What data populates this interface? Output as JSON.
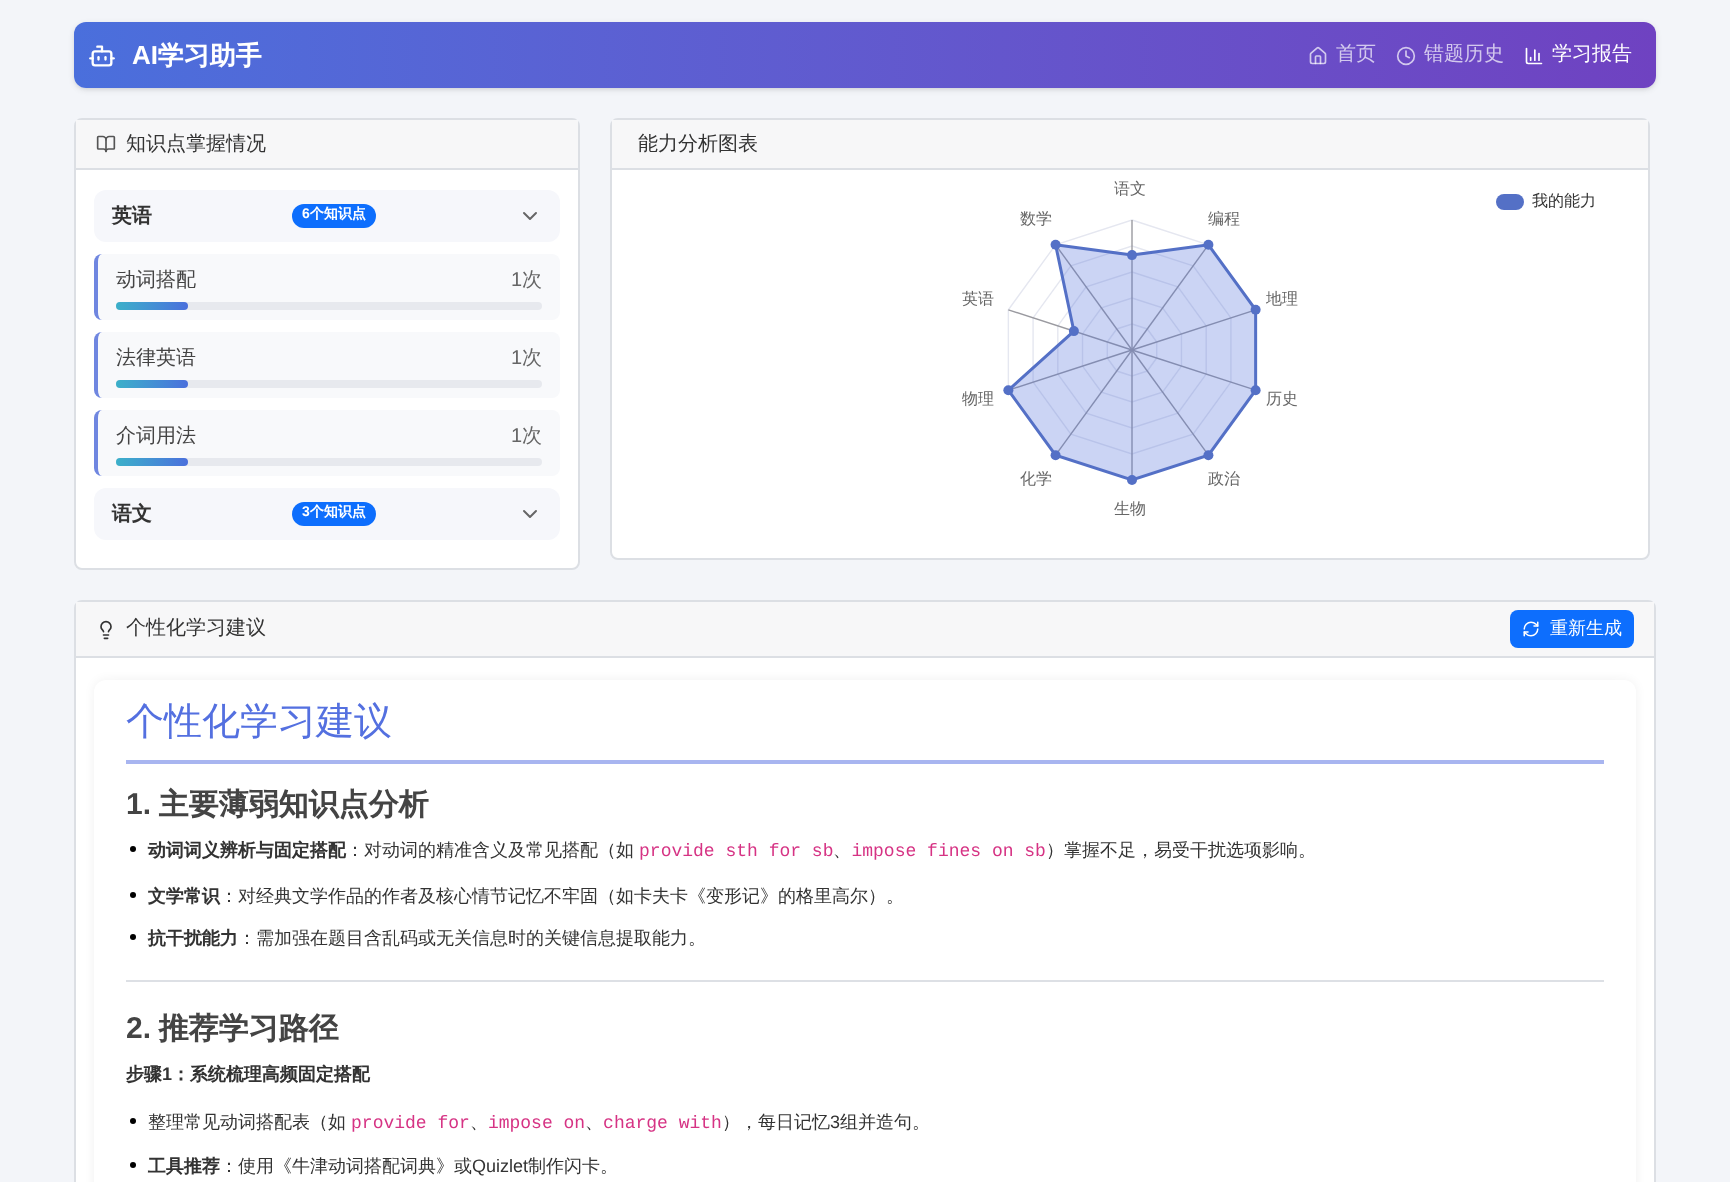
{
  "header": {
    "title": "AI学习助手",
    "nav": [
      {
        "label": "首页",
        "kind": "home",
        "selected": false
      },
      {
        "label": "错题历史",
        "kind": "history",
        "selected": false
      },
      {
        "label": "学习报告",
        "kind": "report",
        "selected": true
      }
    ]
  },
  "knowledge": {
    "title": "知识点掌握情况",
    "subjects": [
      {
        "name": "英语",
        "badge": "6个知识点",
        "points": [
          {
            "name": "动词搭配",
            "count": "1次",
            "level": 0.17
          },
          {
            "name": "法律英语",
            "count": "1次",
            "level": 0.17
          },
          {
            "name": "介词用法",
            "count": "1次",
            "level": 0.17
          }
        ]
      },
      {
        "name": "语文",
        "badge": "3个知识点"
      }
    ]
  },
  "radar": {
    "title": "能力分析图表",
    "legend": "我的能力",
    "axes": [
      "语文",
      "编程",
      "地理",
      "历史",
      "政治",
      "生物",
      "化学",
      "物理",
      "英语",
      "数学"
    ]
  },
  "advice": {
    "title": "个性化学习建议",
    "button": "重新生成",
    "blocks": [
      {
        "kind": "h1",
        "text": "个性化学习建议"
      },
      {
        "kind": "h2",
        "text": "1. 主要薄弱知识点分析"
      },
      {
        "kind": "li",
        "parts": [
          {
            "kind": "bold",
            "text": "动词词义辨析与固定搭配"
          },
          {
            "kind": "text",
            "text": "：对动词的精准含义及常见搭配（如 "
          },
          {
            "kind": "code",
            "text": "provide sth for sb"
          },
          {
            "kind": "text",
            "text": "、"
          },
          {
            "kind": "code",
            "text": "impose fines on sb"
          },
          {
            "kind": "text",
            "text": "）掌握不足，易受干扰选项影响。"
          }
        ]
      },
      {
        "kind": "li",
        "parts": [
          {
            "kind": "bold",
            "text": "文学常识"
          },
          {
            "kind": "text",
            "text": "：对经典文学作品的作者及核心情节记忆不牢固（如卡夫卡《变形记》的格里高尔）。"
          }
        ]
      },
      {
        "kind": "li",
        "parts": [
          {
            "kind": "bold",
            "text": "抗干扰能力"
          },
          {
            "kind": "text",
            "text": "：需加强在题目含乱码或无关信息时的关键信息提取能力。"
          }
        ]
      },
      {
        "kind": "hr"
      },
      {
        "kind": "h2",
        "text": "2. 推荐学习路径"
      },
      {
        "kind": "p",
        "parts": [
          {
            "kind": "bold",
            "text": "步骤1：系统梳理高频固定搭配"
          }
        ]
      },
      {
        "kind": "li",
        "parts": [
          {
            "kind": "text",
            "text": "整理常见动词搭配表（如 "
          },
          {
            "kind": "code",
            "text": "provide for"
          },
          {
            "kind": "text",
            "text": "、"
          },
          {
            "kind": "code",
            "text": "impose on"
          },
          {
            "kind": "text",
            "text": "、"
          },
          {
            "kind": "code",
            "text": "charge with"
          },
          {
            "kind": "text",
            "text": "），每日记忆3组并造句。"
          }
        ]
      },
      {
        "kind": "li",
        "parts": [
          {
            "kind": "bold",
            "text": "工具推荐"
          },
          {
            "kind": "text",
            "text": "：使用《牛津动词搭配词典》或Quizlet制作闪卡。"
          }
        ]
      }
    ]
  }
}
